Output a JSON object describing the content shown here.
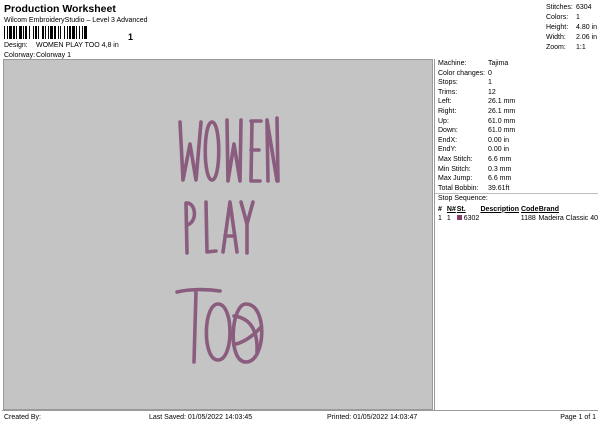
{
  "header": {
    "title": "Production Worksheet",
    "subtitle": "Wilcom EmbroideryStudio – Level 3 Advanced",
    "barcode_suffix": "1"
  },
  "design_meta": {
    "design_label": "Design:",
    "design_value": "WOMEN PLAY TOO 4,8 in",
    "colorway_label": "Colorway:",
    "colorway_value": "Colorway 1"
  },
  "top_stats": [
    {
      "label": "Stitches:",
      "value": "6304"
    },
    {
      "label": "Colors:",
      "value": "1"
    },
    {
      "label": "Height:",
      "value": "4.80 in"
    },
    {
      "label": "Width:",
      "value": "2.06 in"
    },
    {
      "label": "Zoom:",
      "value": "1:1"
    }
  ],
  "design_text": {
    "line1": "WOMEN",
    "line2": "PLAY",
    "line3": "TOO",
    "thread_color": "#8a5c7e",
    "canvas_color": "#c4c4c4"
  },
  "machine_info": [
    {
      "label": "Machine:",
      "value": "Tajima"
    },
    {
      "label": "Color changes:",
      "value": "0"
    },
    {
      "label": "Stops:",
      "value": "1"
    },
    {
      "label": "Trims:",
      "value": "12"
    },
    {
      "label": "Left:",
      "value": "26.1 mm"
    },
    {
      "label": "Right:",
      "value": "26.1 mm"
    },
    {
      "label": "Up:",
      "value": "61.0 mm"
    },
    {
      "label": "Down:",
      "value": "61.0 mm"
    },
    {
      "label": "EndX:",
      "value": "0.00 in"
    },
    {
      "label": "EndY:",
      "value": "0.00 in"
    },
    {
      "label": "Max Stitch:",
      "value": "6.6 mm"
    },
    {
      "label": "Min Stitch:",
      "value": "0.3 mm"
    },
    {
      "label": "Max Jump:",
      "value": "6.6 mm"
    },
    {
      "label": "Total Bobbin:",
      "value": "39.61ft"
    }
  ],
  "stop_sequence": {
    "title": "Stop Sequence:",
    "headers": [
      "#",
      "N#",
      "St.",
      "Description",
      "Code",
      "Brand"
    ],
    "rows": [
      {
        "num": "1",
        "needle": "1",
        "stitches": "6302",
        "description": "",
        "code": "1188",
        "brand": "Madeira Classic 40",
        "color": "#8a3c6e"
      }
    ]
  },
  "footer": {
    "created_by": "Created By:",
    "last_saved": "Last Saved: 01/05/2022 14:03:45",
    "printed": "Printed: 01/05/2022 14:03:47",
    "page": "Page 1 of 1"
  }
}
